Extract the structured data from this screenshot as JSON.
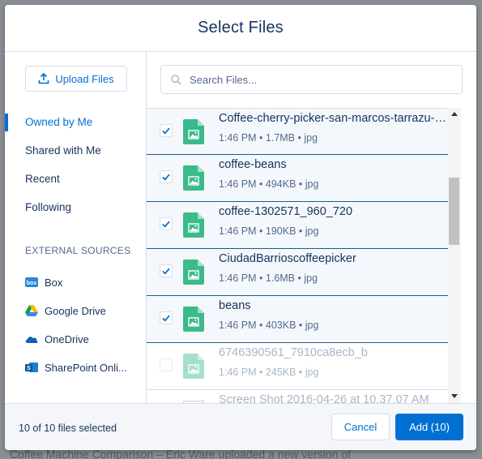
{
  "background": {
    "footer_text": "Coffee Machine Comparison – Eric Ware uploaded a new version of"
  },
  "modal": {
    "title": "Select Files"
  },
  "sidebar": {
    "upload_label": "Upload Files",
    "nav": [
      {
        "label": "Owned by Me",
        "active": true
      },
      {
        "label": "Shared with Me",
        "active": false
      },
      {
        "label": "Recent",
        "active": false
      },
      {
        "label": "Following",
        "active": false
      }
    ],
    "external_label": "EXTERNAL SOURCES",
    "sources": [
      {
        "label": "Box",
        "icon": "box-icon"
      },
      {
        "label": "Google Drive",
        "icon": "google-drive-icon"
      },
      {
        "label": "OneDrive",
        "icon": "onedrive-icon"
      },
      {
        "label": "SharePoint Onli...",
        "icon": "sharepoint-icon"
      }
    ]
  },
  "search": {
    "placeholder": "Search Files..."
  },
  "files": [
    {
      "name": "Coffee-cherry-picker-san-marcos-tarrazu-c...",
      "time": "1:46 PM",
      "size": "1.7MB",
      "type": "jpg",
      "checked": true
    },
    {
      "name": "coffee-beans",
      "time": "1:46 PM",
      "size": "494KB",
      "type": "jpg",
      "checked": true
    },
    {
      "name": "coffee-1302571_960_720",
      "time": "1:46 PM",
      "size": "190KB",
      "type": "jpg",
      "checked": true
    },
    {
      "name": "CiudadBarrioscoffeepicker",
      "time": "1:46 PM",
      "size": "1.6MB",
      "type": "jpg",
      "checked": true
    },
    {
      "name": "beans",
      "time": "1:46 PM",
      "size": "403KB",
      "type": "jpg",
      "checked": true
    },
    {
      "name": "6746390561_7910ca8ecb_b",
      "time": "1:46 PM",
      "size": "245KB",
      "type": "jpg",
      "checked": false
    },
    {
      "name": "Screen Shot 2016-04-26 at 10.37.07 AM",
      "time": "",
      "size": "",
      "type": "",
      "checked": false
    }
  ],
  "footer": {
    "status": "10 of 10 files selected",
    "cancel_label": "Cancel",
    "add_label": "Add (10)"
  },
  "colors": {
    "accent": "#0070d2",
    "text": "#16325c",
    "muted": "#54698d",
    "image_thumb": "#3bba8c",
    "selected_bg": "#f4f8fc"
  }
}
